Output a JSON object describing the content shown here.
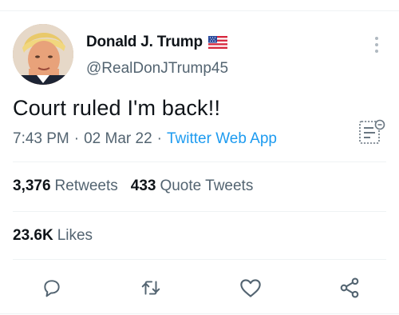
{
  "author": {
    "display_name": "Donald J. Trump",
    "handle": "@RealDonJTrump45",
    "flag_icon": "us-flag-icon"
  },
  "tweet": {
    "text": "Court ruled I'm back!!",
    "time": "7:43 PM",
    "date": "02 Mar 22",
    "separator": "·",
    "source": "Twitter Web App"
  },
  "stats": {
    "retweets_count": "3,376",
    "retweets_label": "Retweets",
    "quotes_count": "433",
    "quotes_label": "Quote Tweets",
    "likes_count": "23.6K",
    "likes_label": "Likes"
  },
  "actions": {
    "reply_icon": "reply-icon",
    "retweet_icon": "retweet-icon",
    "like_icon": "heart-icon",
    "share_icon": "share-icon"
  },
  "colors": {
    "text_primary": "#0f1419",
    "text_secondary": "#536471",
    "link": "#1d9bf0",
    "divider": "#eff3f4"
  }
}
